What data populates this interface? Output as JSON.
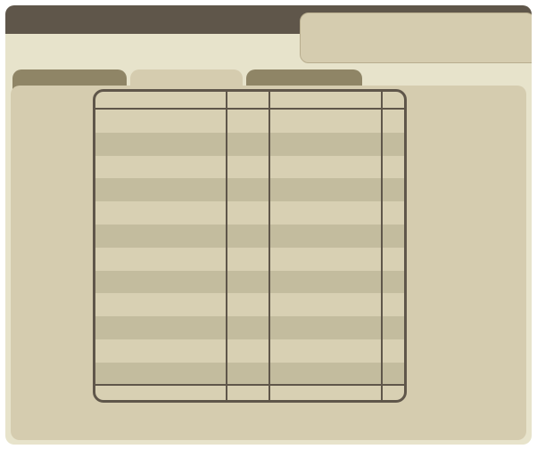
{
  "window": {
    "title": "",
    "header_text": ""
  },
  "tabs": [
    {
      "label": ""
    },
    {
      "label": ""
    },
    {
      "label": ""
    }
  ],
  "table": {
    "columns": [
      "",
      "",
      "",
      ""
    ],
    "row_count": 12,
    "rows": [
      [
        "",
        "",
        "",
        ""
      ],
      [
        "",
        "",
        "",
        ""
      ],
      [
        "",
        "",
        "",
        ""
      ],
      [
        "",
        "",
        "",
        ""
      ],
      [
        "",
        "",
        "",
        ""
      ],
      [
        "",
        "",
        "",
        ""
      ],
      [
        "",
        "",
        "",
        ""
      ],
      [
        "",
        "",
        "",
        ""
      ],
      [
        "",
        "",
        "",
        ""
      ],
      [
        "",
        "",
        "",
        ""
      ],
      [
        "",
        "",
        "",
        ""
      ],
      [
        "",
        "",
        "",
        ""
      ]
    ]
  },
  "colors": {
    "titlebar": "#5f564a",
    "window_bg": "#e7e3cb",
    "panel_bg": "#d5ccaf",
    "tab_inactive": "#8f8566",
    "stripe": "#c3bc9e",
    "grid_line": "#5f564a"
  }
}
